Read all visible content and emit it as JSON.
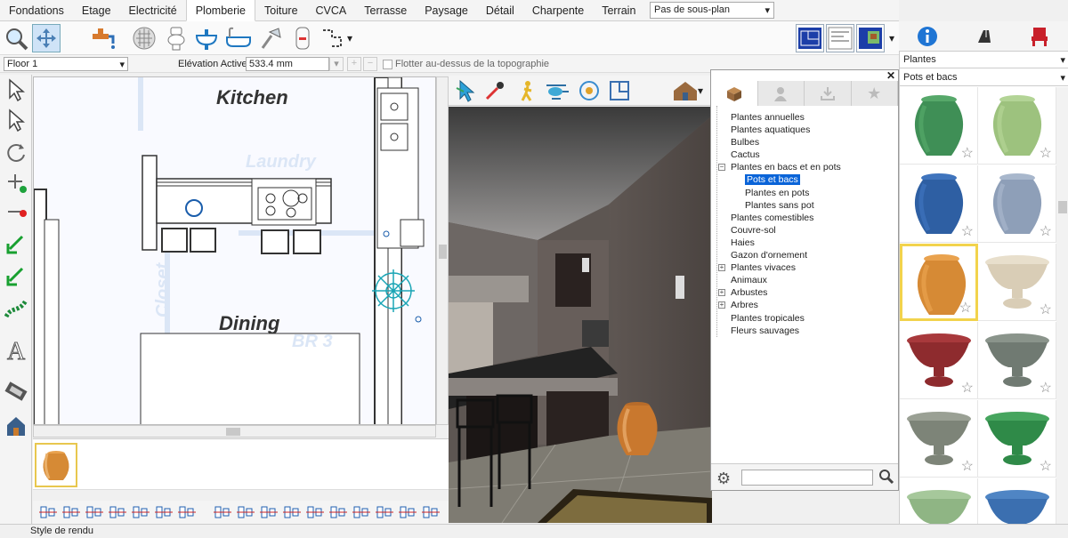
{
  "tabs": [
    "Fondations",
    "Etage",
    "Electricité",
    "Plomberie",
    "Toiture",
    "CVCA",
    "Terrasse",
    "Paysage",
    "Détail",
    "Charpente",
    "Terrain"
  ],
  "active_tab": "Plomberie",
  "subplan_select": "Pas de sous-plan",
  "floor_select": "Floor 1",
  "elevation_label": "Elévation Active:",
  "elevation_value": "533.4 mm",
  "float_label": "Flotter au-dessus de la topographie",
  "plan_labels": {
    "kitchen": "Kitchen",
    "laundry": "Laundry",
    "dining": "Dining",
    "closet": "Closet",
    "br3": "BR 3"
  },
  "right_dropdowns": {
    "category": "Plantes",
    "subcategory": "Pots et bacs"
  },
  "tree": [
    {
      "label": "Plantes annuelles",
      "expander": "",
      "level": 0
    },
    {
      "label": "Plantes aquatiques",
      "expander": "",
      "level": 0
    },
    {
      "label": "Bulbes",
      "expander": "",
      "level": 0
    },
    {
      "label": "Cactus",
      "expander": "",
      "level": 0
    },
    {
      "label": "Plantes en bacs et en pots",
      "expander": "−",
      "level": 0
    },
    {
      "label": "Pots et bacs",
      "expander": "",
      "level": 1,
      "selected": true
    },
    {
      "label": "Plantes en pots",
      "expander": "",
      "level": 1
    },
    {
      "label": "Plantes sans pot",
      "expander": "",
      "level": 1
    },
    {
      "label": "Plantes comestibles",
      "expander": "",
      "level": 0
    },
    {
      "label": "Couvre-sol",
      "expander": "",
      "level": 0
    },
    {
      "label": "Haies",
      "expander": "",
      "level": 0
    },
    {
      "label": "Gazon d'ornement",
      "expander": "",
      "level": 0
    },
    {
      "label": "Plantes vivaces",
      "expander": "+",
      "level": 0
    },
    {
      "label": "Animaux",
      "expander": "",
      "level": 0
    },
    {
      "label": "Arbustes",
      "expander": "+",
      "level": 0
    },
    {
      "label": "Arbres",
      "expander": "+",
      "level": 0
    },
    {
      "label": "Plantes tropicales",
      "expander": "",
      "level": 0
    },
    {
      "label": "Fleurs sauvages",
      "expander": "",
      "level": 0
    }
  ],
  "pot_colors": [
    {
      "body": "#3f8f56",
      "rim": "#56a86a",
      "type": "urn"
    },
    {
      "body": "#9dc27e",
      "rim": "#b3d496",
      "type": "urn"
    },
    {
      "body": "#2e5fa3",
      "rim": "#3f74bd",
      "type": "urn"
    },
    {
      "body": "#8e9fb8",
      "rim": "#a8b7cc",
      "type": "urn"
    },
    {
      "body": "#d68a35",
      "rim": "#e9a24e",
      "type": "urn"
    },
    {
      "body": "#d9cdb6",
      "rim": "#e8dfcc",
      "type": "bowl"
    },
    {
      "body": "#8e2b2e",
      "rim": "#a8393c",
      "type": "bowl"
    },
    {
      "body": "#707a72",
      "rim": "#8a948b",
      "type": "bowl"
    },
    {
      "body": "#7d8478",
      "rim": "#9aa094",
      "type": "bowl"
    },
    {
      "body": "#2f8a48",
      "rim": "#46a55e",
      "type": "bowl"
    },
    {
      "body": "#8fb584",
      "rim": "#a6c89b",
      "type": "bowl"
    },
    {
      "body": "#3b6fb0",
      "rim": "#4f85c4",
      "type": "bowl"
    }
  ],
  "selected_pot_index": 4,
  "status_text": "Style de rendu",
  "colors": {
    "accent": "#0a64d8",
    "select": "#f2d34c"
  }
}
